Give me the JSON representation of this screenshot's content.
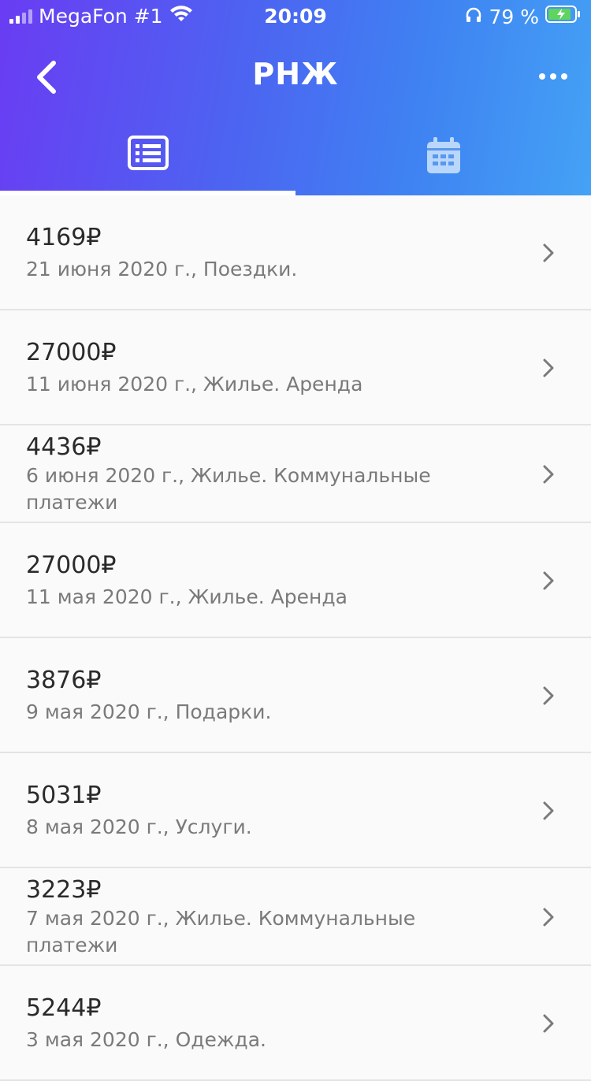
{
  "status": {
    "carrier": "MegaFon #1",
    "time": "20:09",
    "battery": "79 %"
  },
  "nav": {
    "title": "РНЖ",
    "back_icon": "chevron-left-icon",
    "more_icon": "more-horizontal-icon"
  },
  "tabs": [
    {
      "icon": "list-icon",
      "active": true
    },
    {
      "icon": "calendar-icon",
      "active": false
    }
  ],
  "colors": {
    "header_start": "#6a3cf3",
    "header_end": "#44a2f5",
    "text": "#2a2a2a",
    "secondary": "#7a7a7a",
    "divider": "#e4e4e4"
  },
  "transactions": [
    {
      "amount": "4169₽",
      "details": "21 июня 2020 г., Поездки."
    },
    {
      "amount": "27000₽",
      "details": "11 июня 2020 г., Жилье. Аренда"
    },
    {
      "amount": "4436₽",
      "details": "6 июня 2020 г., Жилье. Коммунальные платежи"
    },
    {
      "amount": "27000₽",
      "details": "11 мая 2020 г., Жилье. Аренда"
    },
    {
      "amount": "3876₽",
      "details": "9 мая 2020 г., Подарки."
    },
    {
      "amount": "5031₽",
      "details": "8 мая 2020 г., Услуги."
    },
    {
      "amount": "3223₽",
      "details": "7 мая 2020 г., Жилье. Коммунальные платежи"
    },
    {
      "amount": "5244₽",
      "details": "3 мая 2020 г., Одежда."
    }
  ]
}
